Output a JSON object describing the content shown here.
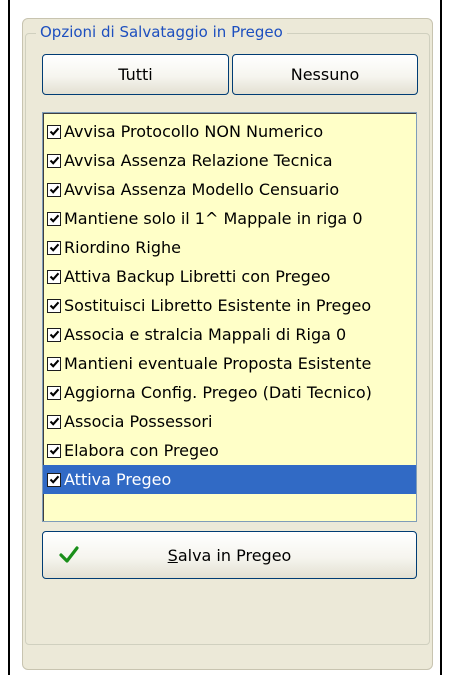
{
  "group": {
    "title": "Opzioni di Salvataggio in Pregeo"
  },
  "buttons": {
    "select_all_label": "Tutti",
    "select_none_label": "Nessuno",
    "save_label_mnemonic": "S",
    "save_label_rest": "alva in Pregeo",
    "save_icon": "check-icon"
  },
  "options": [
    {
      "label": "Avvisa Protocollo NON Numerico",
      "checked": true,
      "selected": false
    },
    {
      "label": "Avvisa Assenza Relazione Tecnica",
      "checked": true,
      "selected": false
    },
    {
      "label": "Avvisa Assenza Modello Censuario",
      "checked": true,
      "selected": false
    },
    {
      "label": "Mantiene solo il 1^ Mappale in riga 0",
      "checked": true,
      "selected": false
    },
    {
      "label": "Riordino Righe",
      "checked": true,
      "selected": false
    },
    {
      "label": "Attiva Backup Libretti con Pregeo",
      "checked": true,
      "selected": false
    },
    {
      "label": "Sostituisci Libretto Esistente in Pregeo",
      "checked": true,
      "selected": false
    },
    {
      "label": "Associa e stralcia Mappali di Riga 0",
      "checked": true,
      "selected": false
    },
    {
      "label": "Mantieni eventuale Proposta Esistente",
      "checked": true,
      "selected": false
    },
    {
      "label": "Aggiorna Config. Pregeo (Dati Tecnico)",
      "checked": true,
      "selected": false
    },
    {
      "label": "Associa Possessori",
      "checked": true,
      "selected": false
    },
    {
      "label": "Elabora con Pregeo",
      "checked": true,
      "selected": false
    },
    {
      "label": "Attiva Pregeo",
      "checked": true,
      "selected": true
    }
  ],
  "colors": {
    "list_background": "#ffffc8",
    "selection": "#316ac5",
    "group_title": "#1d4fbf",
    "check_icon": "#1a8f1a"
  }
}
